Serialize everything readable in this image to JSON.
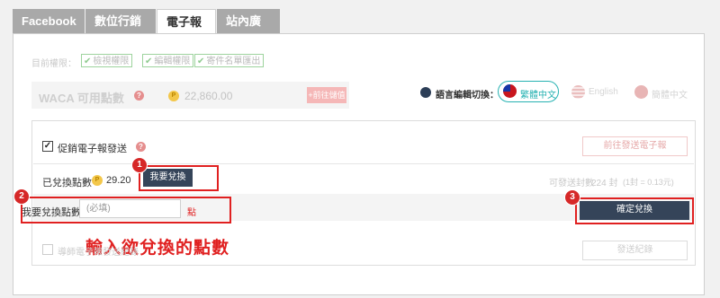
{
  "tabs": [
    {
      "label": "Facebook"
    },
    {
      "label": "數位行銷"
    },
    {
      "label": "電子報"
    },
    {
      "label": "站內廣告"
    }
  ],
  "permissions": {
    "label": "目前權限：",
    "items": [
      "檢視權限",
      "編輯權限",
      "寄件名單匯出"
    ]
  },
  "points": {
    "label": "WACA 可用點數",
    "value": "22,860.00",
    "buy_button": "+前往儲值"
  },
  "language": {
    "label": "語言編輯切換：",
    "options": [
      {
        "label": "繁體中文",
        "active": true
      },
      {
        "label": "English",
        "active": false
      },
      {
        "label": "簡體中文",
        "active": false
      }
    ]
  },
  "newsletter": {
    "promo_label": "促銷電子報發送",
    "promo_checked": true,
    "go_send_button": "前往發送電子報",
    "exchanged_label": "已兌換點數",
    "exchanged_value": "29.20",
    "exchange_button": "我要兌換",
    "sendable_label": "可發送封數",
    "sendable_value": "224 封",
    "rate_note": "(1封 = 0.13元)",
    "input_label": "我要兌換點數",
    "input_placeholder": "(必填)",
    "input_unit": "點",
    "confirm_button": "確定兌換",
    "footer_check_label": "導師電子報發送紀錄",
    "record_button": "發送紀錄"
  },
  "annotations": {
    "badges": [
      "1",
      "2",
      "3"
    ],
    "instruction": "輸入欲兌換的點數"
  },
  "colors": {
    "accent_teal": "#27b2b2",
    "dark_button": "#354459",
    "annotation_red": "#e02020",
    "tab_gray": "#a9a9a9"
  }
}
